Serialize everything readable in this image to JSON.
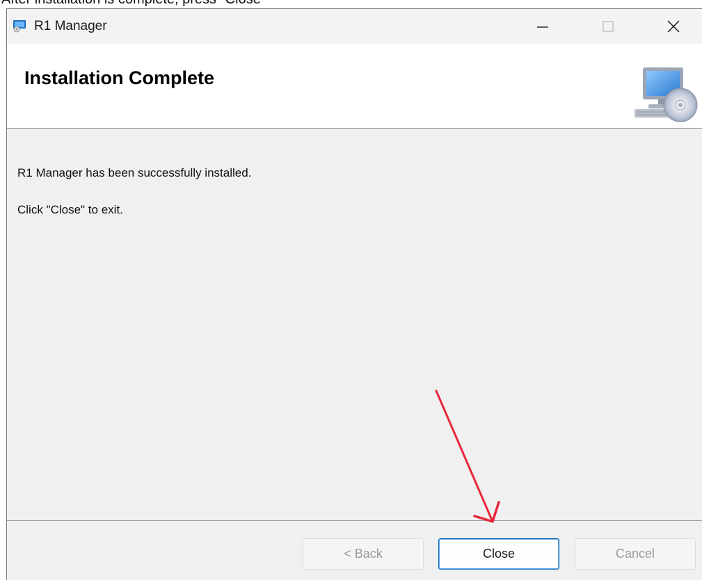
{
  "caption": "After installation is complete, press \"Close\"",
  "window": {
    "title": "R1 Manager"
  },
  "header": {
    "title": "Installation Complete"
  },
  "body": {
    "line1": "R1 Manager has been successfully installed.",
    "line2": "Click \"Close\" to exit."
  },
  "buttons": {
    "back_label": "< Back",
    "close_label": "Close",
    "cancel_label": "Cancel"
  },
  "icons": {
    "app": "installer-app-icon",
    "header": "computer-disc-icon",
    "annotation": "red-arrow-icon"
  },
  "colors": {
    "accent": "#0067c0",
    "annotation": "#e8273a"
  }
}
